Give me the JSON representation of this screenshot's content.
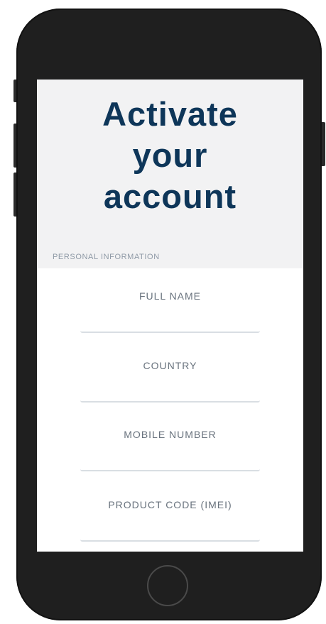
{
  "page": {
    "title_lines": [
      "Activate",
      "your",
      "account"
    ],
    "section_label": "PERSONAL INFORMATION"
  },
  "form": {
    "fields": [
      {
        "label": "FULL NAME",
        "value": ""
      },
      {
        "label": "COUNTRY",
        "value": ""
      },
      {
        "label": "MOBILE NUMBER",
        "value": ""
      },
      {
        "label": "PRODUCT CODE (IMEI)",
        "value": ""
      }
    ]
  },
  "colors": {
    "title": "#0e3659",
    "hero_background": "#f2f2f3",
    "device_body": "#1f1f1f",
    "field_underline": "#d9dee3"
  }
}
